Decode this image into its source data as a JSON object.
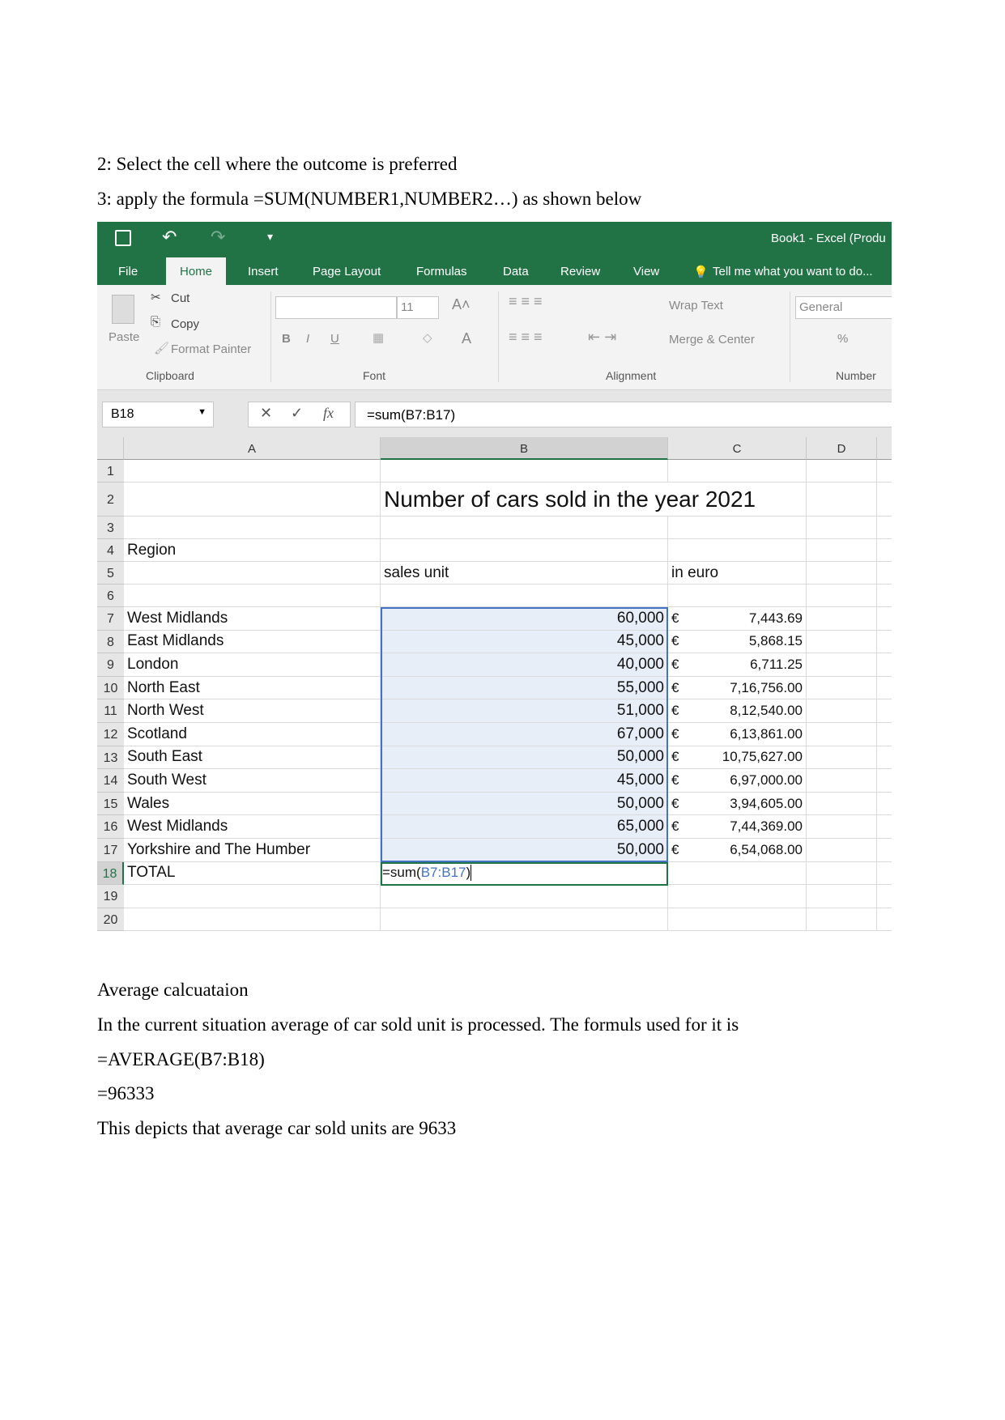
{
  "intro": [
    "2: Select the cell where the outcome is preferred",
    "3: apply the formula =SUM(NUMBER1,NUMBER2…) as shown below"
  ],
  "excel": {
    "window_title": "Book1 - Excel (Produ",
    "tabs": [
      "File",
      "Home",
      "Insert",
      "Page Layout",
      "Formulas",
      "Data",
      "Review",
      "View"
    ],
    "tell_me": "Tell me what you want to do...",
    "ribbon": {
      "paste": "Paste",
      "cut": "Cut",
      "copy": "Copy",
      "format_painter": "Format Painter",
      "clipboard": "Clipboard",
      "font_size": "11",
      "font": "Font",
      "wrap_text": "Wrap Text",
      "merge_center": "Merge & Center",
      "alignment": "Alignment",
      "number_format": "General",
      "number": "Number",
      "bold": "B",
      "italic": "I",
      "underline": "U",
      "percent": "%"
    },
    "name_box": "B18",
    "formula": "=sum(B7:B17)",
    "columns": [
      "A",
      "B",
      "C",
      "D"
    ],
    "title": "Number of cars sold in the year 2021",
    "region_header": "Region",
    "sales_header": "sales unit",
    "euro_header": "in euro",
    "currency": "€",
    "rows": [
      {
        "r": "7",
        "region": "West Midlands",
        "units": "60,000",
        "euro": "7,443.69"
      },
      {
        "r": "8",
        "region": "East Midlands",
        "units": "45,000",
        "euro": "5,868.15"
      },
      {
        "r": "9",
        "region": "London",
        "units": "40,000",
        "euro": "6,711.25"
      },
      {
        "r": "10",
        "region": "North East",
        "units": "55,000",
        "euro": "7,16,756.00"
      },
      {
        "r": "11",
        "region": "North West",
        "units": "51,000",
        "euro": "8,12,540.00"
      },
      {
        "r": "12",
        "region": "Scotland",
        "units": "67,000",
        "euro": "6,13,861.00"
      },
      {
        "r": "13",
        "region": "South East",
        "units": "50,000",
        "euro": "10,75,627.00"
      },
      {
        "r": "14",
        "region": "South West",
        "units": "45,000",
        "euro": "6,97,000.00"
      },
      {
        "r": "15",
        "region": "Wales",
        "units": "50,000",
        "euro": "3,94,605.00"
      },
      {
        "r": "16",
        "region": "West Midlands",
        "units": "65,000",
        "euro": "7,44,369.00"
      },
      {
        "r": "17",
        "region": "Yorkshire and The Humber",
        "units": "50,000",
        "euro": "6,54,068.00"
      }
    ],
    "total_label": "TOTAL",
    "edit_prefix": "=sum(",
    "edit_ref": "B7:B17",
    "edit_suffix": ")",
    "row_numbers": [
      "1",
      "2",
      "3",
      "4",
      "5",
      "6",
      "18",
      "19",
      "20"
    ],
    "ref_color": "#4472c4",
    "brand_color": "#217346"
  },
  "outro": [
    "Average calcuataion",
    "In the current situation average of car sold unit is processed. The formuls used for it is",
    "=AVERAGE(B7:B18)",
    "=96333",
    "This depicts that average car sold units are 9633"
  ]
}
